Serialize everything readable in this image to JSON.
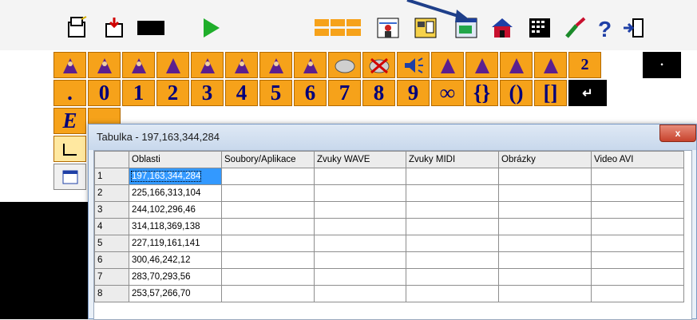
{
  "keys_row1": [
    "2"
  ],
  "keys_row2": [
    ".",
    "0",
    "1",
    "2",
    "3",
    "4",
    "5",
    "6",
    "7",
    "8",
    "9",
    "∞",
    "{}",
    "()",
    "[]"
  ],
  "window": {
    "title": "Tabulka - 197,163,344,284",
    "close_label": "x"
  },
  "table": {
    "headers": [
      "Oblasti",
      "Soubory/Aplikace",
      "Zvuky WAVE",
      "Zvuky MIDI",
      "Obrázky",
      "Video AVI"
    ],
    "rows": [
      {
        "num": "1",
        "oblast": "197,163,344,284"
      },
      {
        "num": "2",
        "oblast": "225,166,313,104"
      },
      {
        "num": "3",
        "oblast": "244,102,296,46"
      },
      {
        "num": "4",
        "oblast": "314,118,369,138"
      },
      {
        "num": "5",
        "oblast": "227,119,161,141"
      },
      {
        "num": "6",
        "oblast": "300,46,242,12"
      },
      {
        "num": "7",
        "oblast": "283,70,293,56"
      },
      {
        "num": "8",
        "oblast": "253,57,266,70"
      }
    ]
  }
}
